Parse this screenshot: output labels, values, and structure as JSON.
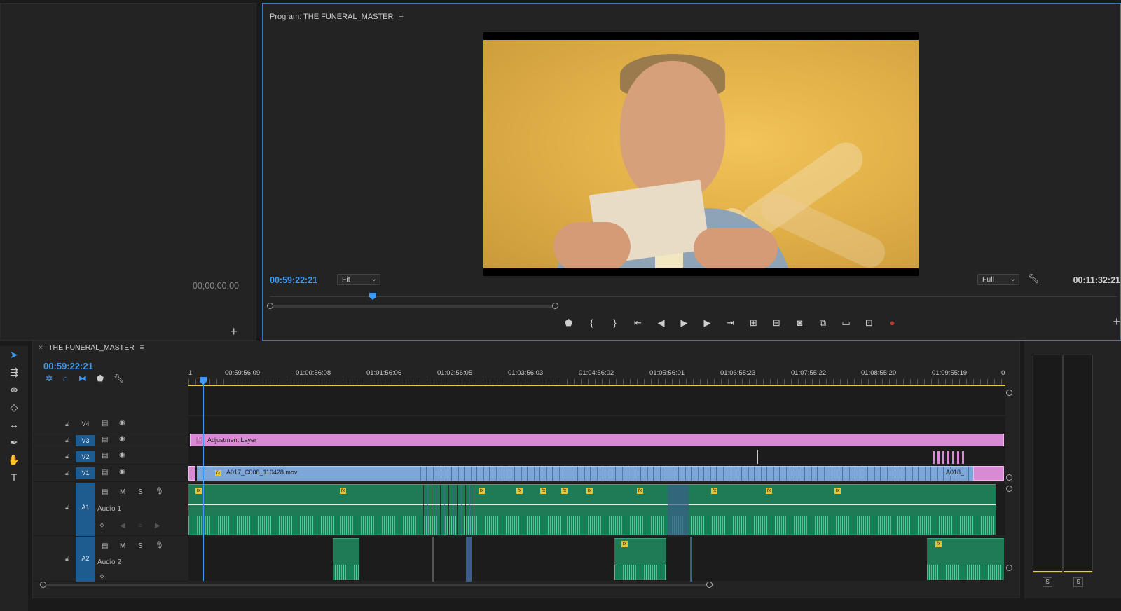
{
  "source_monitor": {
    "timecode": "00;00;00;00",
    "add_symbol": "+"
  },
  "program_monitor": {
    "title": "Program: THE FUNERAL_MASTER",
    "menu_symbol": "≡",
    "current_timecode": "00:59:22:21",
    "zoom": "Fit",
    "resolution": "Full",
    "duration": "00:11:32:21",
    "add_symbol": "+"
  },
  "timeline": {
    "tab_title": "THE FUNERAL_MASTER",
    "close_symbol": "×",
    "menu_symbol": "≡",
    "current_timecode": "00:59:22:21",
    "ruler_start": "1",
    "ruler_end": "0",
    "ruler_labels": [
      "00:59:56:09",
      "01:00:56:08",
      "01:01:56:06",
      "01:02:56:05",
      "01:03:56:03",
      "01:04:56:02",
      "01:05:56:01",
      "01:06:55:23",
      "01:07:55:22",
      "01:08:55:20",
      "01:09:55:19"
    ],
    "tracks": {
      "v4": "V4",
      "v3": "V3",
      "v2": "V2",
      "v1": "V1",
      "a1": "A1",
      "a1_name": "Audio 1",
      "a2": "A2",
      "a2_name": "Audio 2",
      "m": "M",
      "s": "S"
    },
    "clips": {
      "adjustment": "Adjustment Layer",
      "v1_main": "A017_C008_110428.mov",
      "v1_end": "A018_"
    }
  },
  "meters": {
    "solo_left": "S",
    "solo_right": "S"
  }
}
